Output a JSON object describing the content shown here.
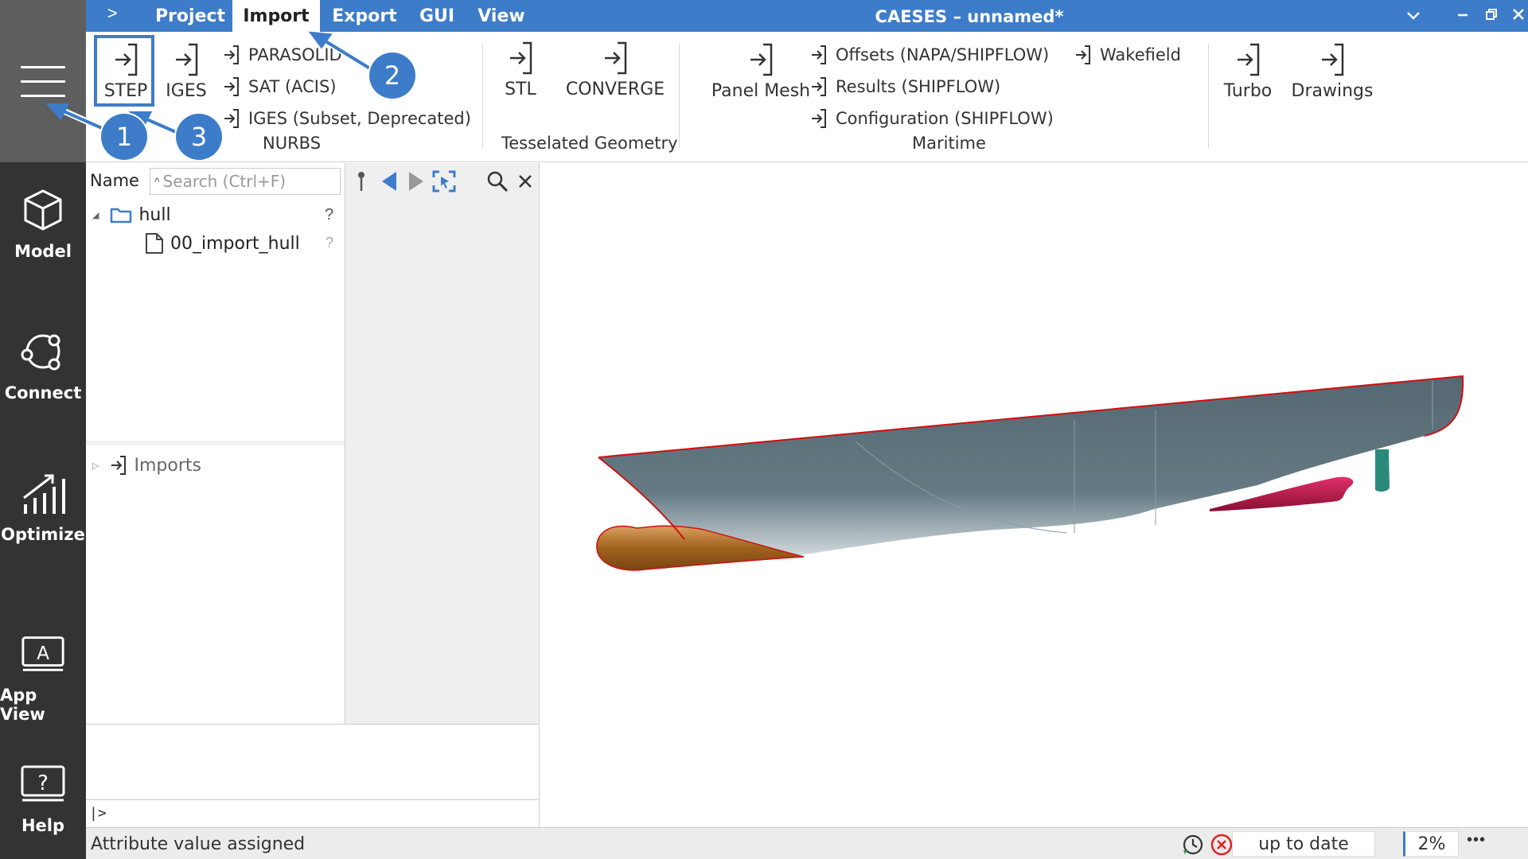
{
  "titlebar": {
    "expand_glyph": ">",
    "tabs": [
      "Project",
      "Import",
      "Export",
      "GUI",
      "View"
    ],
    "active_tab": "Import",
    "app_title": "CAESES – unnamed*"
  },
  "sidebar": {
    "items": [
      {
        "label": "Model",
        "icon": "cube-icon"
      },
      {
        "label": "Connect",
        "icon": "connect-icon"
      },
      {
        "label": "Optimize",
        "icon": "chart-icon"
      },
      {
        "label": "App View",
        "icon": "app-view-icon"
      },
      {
        "label": "Help",
        "icon": "help-icon"
      }
    ]
  },
  "ribbon": {
    "step": "STEP",
    "iges": "IGES",
    "parasolid": "PARASOLID",
    "sat": "SAT (ACIS)",
    "iges_subset": "IGES (Subset, Deprecated)",
    "group_nurbs": "NURBS",
    "stl": "STL",
    "converge": "CONVERGE",
    "group_tess": "Tesselated Geometry",
    "panel_mesh": "Panel Mesh",
    "offsets": "Offsets (NAPA/SHIPFLOW)",
    "results": "Results (SHIPFLOW)",
    "configuration": "Configuration (SHIPFLOW)",
    "wakefield": "Wakefield",
    "group_maritime": "Maritime",
    "turbo": "Turbo",
    "drawings": "Drawings"
  },
  "tree": {
    "column_name": "Name",
    "search_placeholder": "Search (Ctrl+F)",
    "folder": "hull",
    "folder_q": "?",
    "file": "00_import_hull",
    "file_q": "?",
    "imports": "Imports"
  },
  "console": {
    "prompt": "|>"
  },
  "status": {
    "message": "Attribute value assigned",
    "state": "up to date",
    "zoom": "2%",
    "more": "•••"
  },
  "callouts": [
    "1",
    "2",
    "3"
  ],
  "colors": {
    "accent": "#3d7cc9",
    "sidebar": "#333333",
    "hull": "#5a6e78",
    "bulb": "#a0621e",
    "skeg": "#c4184a",
    "rudder": "#2a8a7a",
    "outline": "#d01010"
  }
}
